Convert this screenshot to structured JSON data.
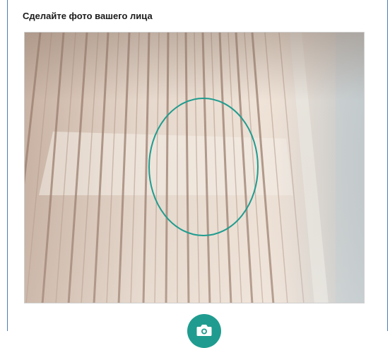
{
  "header": {
    "title": "Сделайте фото вашего лица"
  },
  "camera": {
    "feed_name": "camera-feed",
    "guide_color": "#1f9c8f"
  },
  "actions": {
    "capture_icon": "camera-icon"
  },
  "colors": {
    "accent": "#1f9c8f",
    "frame_border": "#4a7fb5"
  }
}
